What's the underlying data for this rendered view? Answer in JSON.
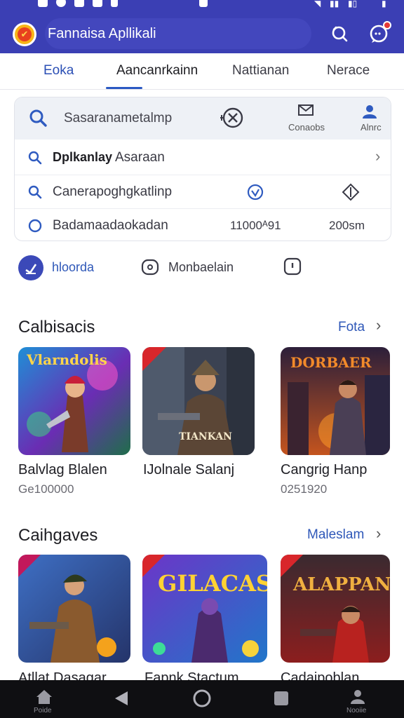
{
  "app": {
    "title": "Fannaisa Apllikali"
  },
  "tabs": [
    {
      "label": "Eoka"
    },
    {
      "label": "Aancanrkainn"
    },
    {
      "label": "Nattianan"
    },
    {
      "label": "Neracе"
    }
  ],
  "search": {
    "placeholder": "Sasaranametalmp",
    "shortcut_1": "Conaobs",
    "shortcut_2": "Alnrc"
  },
  "suggestions": [
    {
      "strong": "Dplkanlay",
      "rest": " Asaraan"
    },
    {
      "text": "Canerapoghgkatlinp"
    },
    {
      "text": "Badamaadaokadan",
      "value_1": "11000ᴬ91",
      "value_2": "200sm"
    }
  ],
  "chips": [
    {
      "label": "hloorda"
    },
    {
      "label": "Monbaelain"
    }
  ],
  "sections": [
    {
      "title": "Calbisacis",
      "link": "Fota",
      "games": [
        {
          "name": "Balvlag Blalen",
          "meta": "Ge100000",
          "art": "Vlarndolis"
        },
        {
          "name": "IJolnale Salanj",
          "meta": "",
          "art": "TIANKAN"
        },
        {
          "name": "Cangrig Hanp",
          "meta": "0251920",
          "art": "DORBAER"
        }
      ]
    },
    {
      "title": "Caihgaves",
      "link": "Maleslam",
      "games": [
        {
          "name": "Atllat Dasagar",
          "art": ""
        },
        {
          "name": "Fapnk Stactum",
          "art": "GILACAS"
        },
        {
          "name": "Cadaipoblan",
          "art": "ALAPPAN"
        }
      ]
    }
  ],
  "bottom_nav": {
    "home_label": "Poide",
    "profile_label": "Nooiie"
  },
  "colors": {
    "brand": "#3b3fb4",
    "accent": "#2e57b8",
    "nav": "#0f0f12"
  }
}
